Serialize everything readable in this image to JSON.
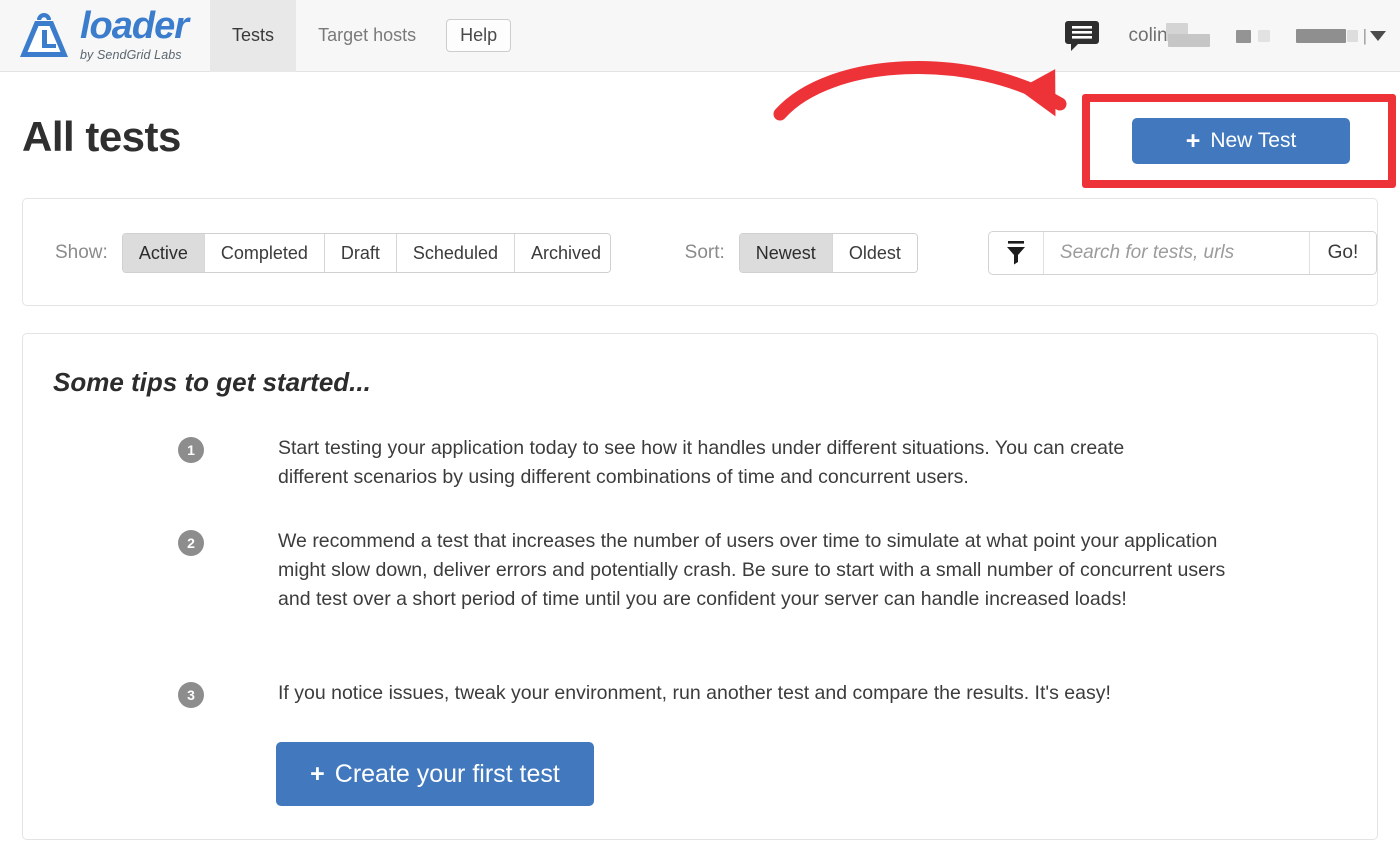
{
  "brand": {
    "name": "loader",
    "tagline": "by SendGrid Labs",
    "logo_icon": "weight-logo-icon",
    "color": "#3b7dcc"
  },
  "nav": {
    "items": [
      {
        "label": "Tests",
        "active": true
      },
      {
        "label": "Target hosts",
        "active": false
      }
    ],
    "help_label": "Help"
  },
  "account": {
    "chat_icon": "chat-bubble-icon",
    "user_name": "colin",
    "caret_icon": "chevron-down-icon",
    "separator": "|"
  },
  "header": {
    "title": "All tests",
    "new_test_label": "New Test",
    "plus_icon": "plus-icon",
    "button_color": "#4279be"
  },
  "annotation": {
    "highlight_color": "#ee3338",
    "arrow_icon": "curved-arrow-icon",
    "box_target": "new-test-button"
  },
  "filters": {
    "show_label": "Show:",
    "show_options": [
      "Active",
      "Completed",
      "Draft",
      "Scheduled",
      "Archived"
    ],
    "show_selected": "Active",
    "sort_label": "Sort:",
    "sort_options": [
      "Newest",
      "Oldest"
    ],
    "sort_selected": "Newest",
    "filter_icon": "funnel-icon",
    "search_placeholder": "Search for tests, urls",
    "search_value": "",
    "go_label": "Go!"
  },
  "tips": {
    "title": "Some tips to get started...",
    "items": [
      {
        "number": "1",
        "text": "Start testing your application today to see how it handles under different situations. You can create different scenarios by using different combinations of time and concurrent users."
      },
      {
        "number": "2",
        "text": "We recommend a test that increases the number of users over time to simulate at what point your application might slow down, deliver errors and potentially crash. Be sure to start with a small number of concurrent users and test over a short period of time until you are confident your server can handle increased loads!"
      },
      {
        "number": "3",
        "text": "If you notice issues, tweak your environment, run another test and compare the results. It's easy!"
      }
    ],
    "cta_label": "Create your first test",
    "cta_plus_icon": "plus-icon"
  }
}
